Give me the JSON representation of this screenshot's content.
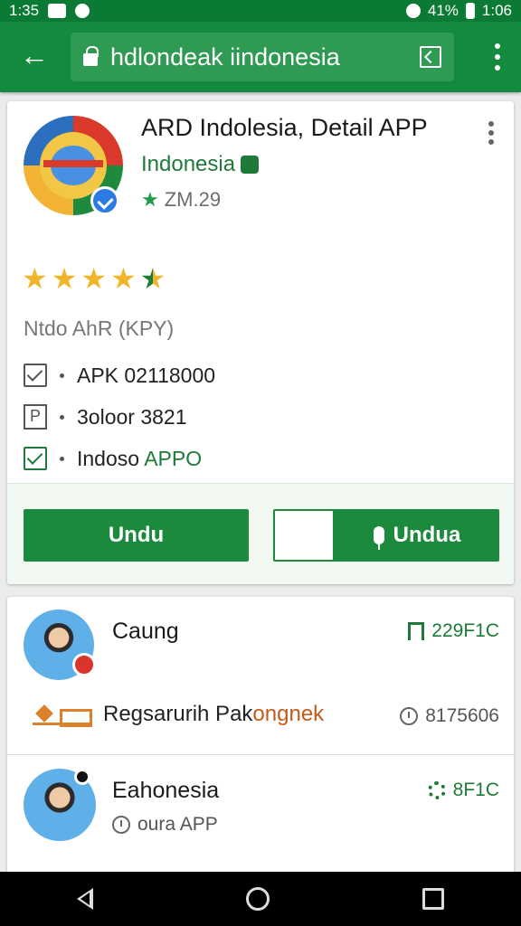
{
  "status_bar": {
    "time_left": "1:35",
    "battery": "41%",
    "time_right": "1:06"
  },
  "toolbar": {
    "url": "hdlondeak iindonesia",
    "back_icon": "back-arrow-icon",
    "action_icon": "open-in-app-icon",
    "menu_icon": "more-vert-icon"
  },
  "app": {
    "title": "ARD Indolesia, Detail APP",
    "developer": "Indonesia",
    "meta": "ZM.29",
    "rating_stars": 4.5,
    "section_label": "Ntdo AhR (KPY)",
    "info": [
      {
        "text": "APK 02118000",
        "accent": ""
      },
      {
        "text": "3oloor 3821",
        "accent": ""
      },
      {
        "text": "Indoso ",
        "accent": "APPO"
      }
    ],
    "install_label": "Undu",
    "install2_label": "Undua"
  },
  "list": [
    {
      "title": "Caung",
      "meta": "229F1C"
    },
    {
      "title": "Regsarurih Pak",
      "title_accent": "ongnek",
      "meta": "8175606"
    },
    {
      "title": "Eahonesia",
      "subtitle": "oura APP",
      "meta": "8F1C"
    }
  ],
  "colors": {
    "primary": "#138a3e",
    "status_bar": "#0b7a34",
    "accent_green": "#1f7a3a",
    "star": "#f0b52a"
  }
}
